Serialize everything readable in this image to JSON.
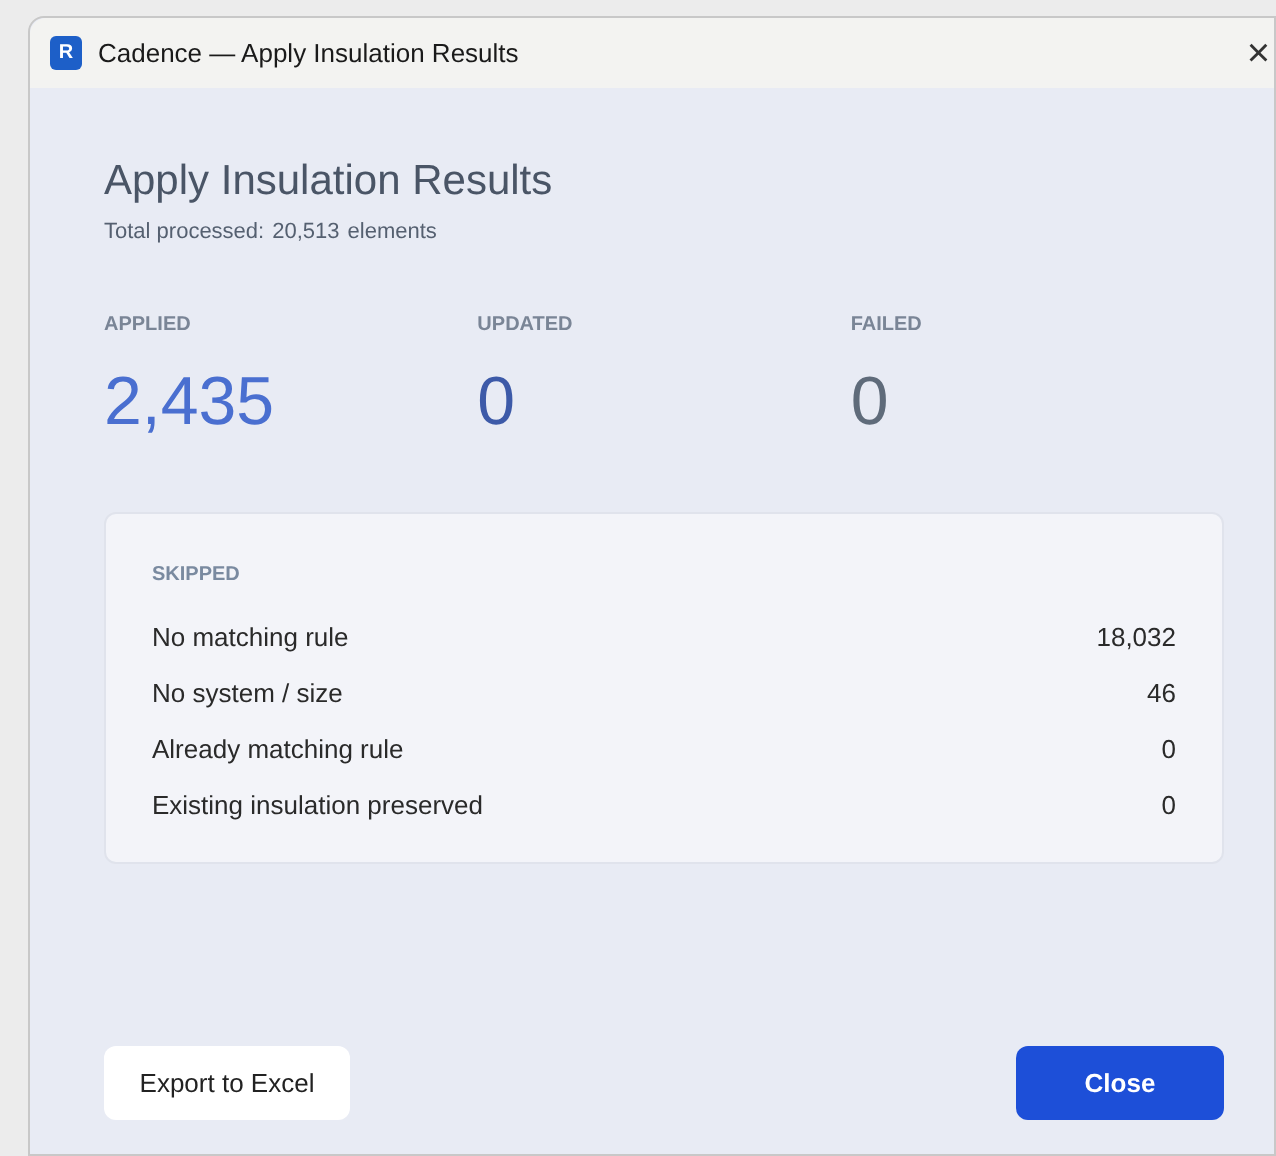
{
  "window": {
    "title": "Cadence — Apply Insulation Results",
    "app_icon_letter": "R",
    "close_glyph": "×"
  },
  "heading": "Apply Insulation Results",
  "summary": {
    "label": "Total processed:",
    "count": "20,513",
    "unit": "elements"
  },
  "stats": [
    {
      "label": "APPLIED",
      "value": "2,435",
      "color": "#4a6fd0"
    },
    {
      "label": "UPDATED",
      "value": "0",
      "color": "#3d5aa8"
    },
    {
      "label": "FAILED",
      "value": "0",
      "color": "#5f6b7a"
    }
  ],
  "skipped": {
    "title": "SKIPPED",
    "rows": [
      {
        "label": "No matching rule",
        "value": "18,032"
      },
      {
        "label": "No system / size",
        "value": "46"
      },
      {
        "label": "Already matching rule",
        "value": "0"
      },
      {
        "label": "Existing insulation preserved",
        "value": "0"
      }
    ]
  },
  "buttons": [
    {
      "label": "Export to Excel",
      "kind": "secondary"
    },
    {
      "label": "Close",
      "kind": "primary"
    }
  ]
}
